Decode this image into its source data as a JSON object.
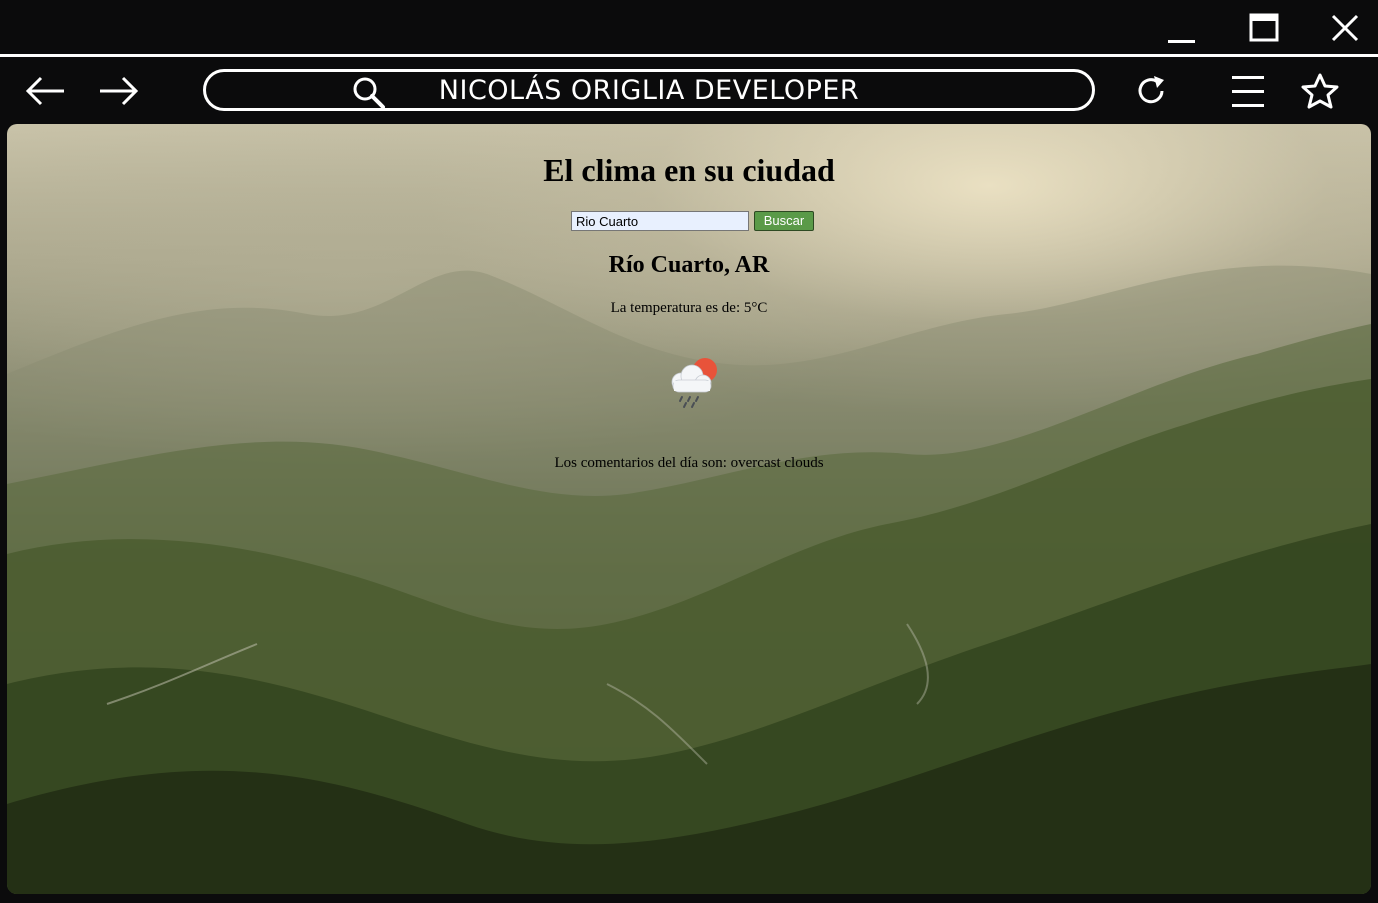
{
  "window": {
    "minimize_icon": "minimize-icon",
    "maximize_icon": "maximize-icon",
    "close_icon": "close-icon"
  },
  "browser": {
    "back_icon": "arrow-left-icon",
    "forward_icon": "arrow-right-icon",
    "search_icon": "magnifier-icon",
    "url_text": "NICOLÁS ORIGLIA DEVELOPER",
    "reload_icon": "reload-icon",
    "menu_icon": "hamburger-icon",
    "bookmark_icon": "star-icon"
  },
  "page": {
    "title": "El clima en su ciudad",
    "search": {
      "value": "Rio Cuarto",
      "button_label": "Buscar"
    },
    "city": "Río Cuarto, AR",
    "temperature_text": "La temperatura es de: 5°C",
    "weather_icon": "rain-cloud-sun-icon",
    "description_text": "Los comentarios del día son: overcast clouds"
  },
  "colors": {
    "chrome_bg": "#0b0b0c",
    "chrome_fg": "#ffffff",
    "button_green": "#5a9a48",
    "input_bg": "#e8f0fe",
    "sun": "#e8533a"
  }
}
